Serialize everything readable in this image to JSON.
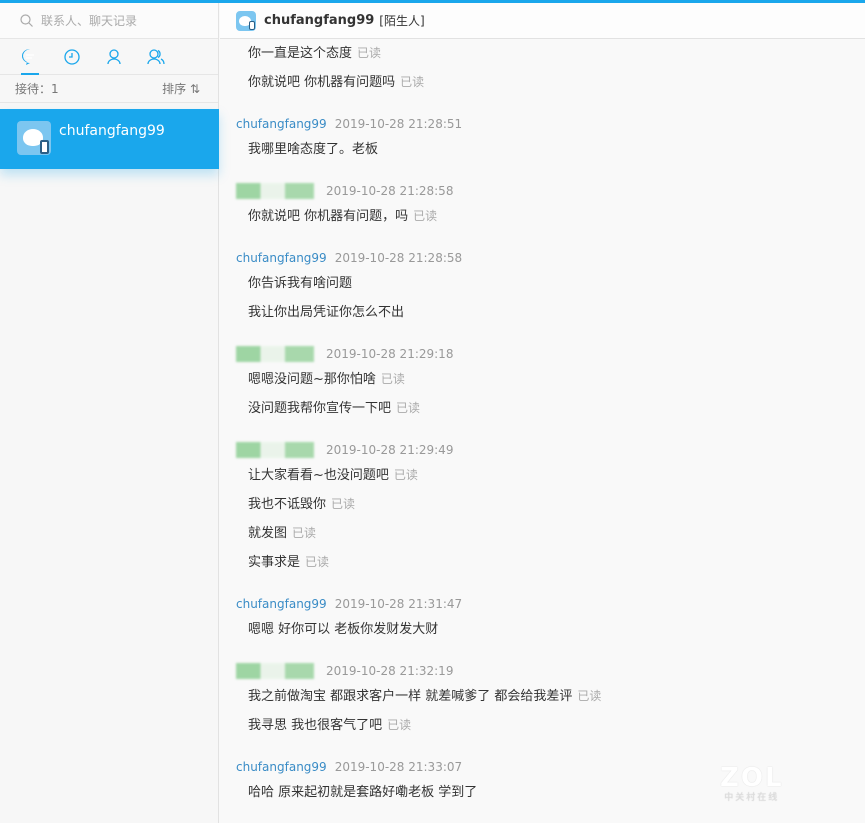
{
  "sidebar": {
    "search_placeholder": "联系人、聊天记录",
    "stats_label": "接待：1",
    "sort_label": "排序 ⇅",
    "contact": {
      "name": "chufangfang99"
    }
  },
  "chat": {
    "name": "chufangfang99",
    "tag": "[陌生人]",
    "read_label": "已读",
    "groups": [
      {
        "sender": "",
        "time": "",
        "messages": [
          {
            "text": "你一直是这个态度",
            "read": true
          },
          {
            "text": "你就说吧 你机器有问题吗",
            "read": true
          }
        ]
      },
      {
        "sender": "chufangfang99",
        "time": "2019-10-28 21:28:51",
        "messages": [
          {
            "text": "我哪里啥态度了。老板",
            "read": false
          }
        ]
      },
      {
        "sender": "redacted",
        "time": "2019-10-28 21:28:58",
        "messages": [
          {
            "text": "你就说吧 你机器有问题，吗",
            "read": true
          }
        ]
      },
      {
        "sender": "chufangfang99",
        "time": "2019-10-28 21:28:58",
        "messages": [
          {
            "text": "你告诉我有啥问题",
            "read": false
          },
          {
            "text": "我让你出局凭证你怎么不出",
            "read": false
          }
        ]
      },
      {
        "sender": "redacted",
        "time": "2019-10-28 21:29:18",
        "messages": [
          {
            "text": "嗯嗯没问题~那你怕啥",
            "read": true
          },
          {
            "text": "没问题我帮你宣传一下吧",
            "read": true
          }
        ]
      },
      {
        "sender": "redacted",
        "time": "2019-10-28 21:29:49",
        "messages": [
          {
            "text": "让大家看看~也没问题吧",
            "read": true
          },
          {
            "text": "我也不诋毁你",
            "read": true
          },
          {
            "text": "就发图",
            "read": true
          },
          {
            "text": "实事求是",
            "read": true
          }
        ]
      },
      {
        "sender": "chufangfang99",
        "time": "2019-10-28 21:31:47",
        "messages": [
          {
            "text": "嗯嗯 好你可以 老板你发财发大财",
            "read": false
          }
        ]
      },
      {
        "sender": "redacted",
        "time": "2019-10-28 21:32:19",
        "messages": [
          {
            "text": "我之前做淘宝 都跟求客户一样 就差喊爹了 都会给我差评",
            "read": true
          },
          {
            "text": "我寻思 我也很客气了吧",
            "read": true
          }
        ]
      },
      {
        "sender": "chufangfang99",
        "time": "2019-10-28 21:33:07",
        "messages": [
          {
            "text": "哈哈 原来起初就是套路好嘞老板 学到了",
            "read": false
          }
        ]
      }
    ]
  },
  "watermark": {
    "logo": "ZOL",
    "sub": "中关村在线"
  }
}
